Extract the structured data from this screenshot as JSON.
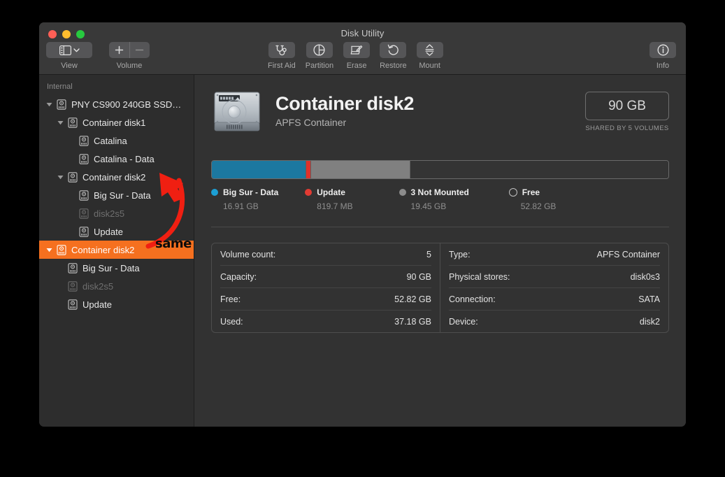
{
  "window": {
    "title": "Disk Utility",
    "traffic_lights": [
      "close",
      "minimize",
      "maximize"
    ]
  },
  "toolbar": {
    "view": {
      "label": "View",
      "icon": "sidebar-icon",
      "chevron": "chevron-down-icon"
    },
    "volume": {
      "label": "Volume",
      "add": "+",
      "remove": "–"
    },
    "actions": [
      {
        "label": "First Aid",
        "icon": "stethoscope-icon"
      },
      {
        "label": "Partition",
        "icon": "pie-chart-icon"
      },
      {
        "label": "Erase",
        "icon": "erase-icon"
      },
      {
        "label": "Restore",
        "icon": "undo-arrow-icon"
      },
      {
        "label": "Mount",
        "icon": "eject-icon"
      }
    ],
    "info": {
      "label": "Info",
      "icon": "info-circle-icon"
    }
  },
  "sidebar": {
    "header": "Internal",
    "items": [
      {
        "label": "PNY CS900 240GB SSD…",
        "indent": 0,
        "twisty": "down",
        "selected": false,
        "dim": false
      },
      {
        "label": "Container disk1",
        "indent": 1,
        "twisty": "down",
        "selected": false,
        "dim": false
      },
      {
        "label": "Catalina",
        "indent": 2,
        "twisty": "none",
        "selected": false,
        "dim": false
      },
      {
        "label": "Catalina - Data",
        "indent": 2,
        "twisty": "none",
        "selected": false,
        "dim": false
      },
      {
        "label": "Container disk2",
        "indent": 1,
        "twisty": "down",
        "selected": false,
        "dim": false
      },
      {
        "label": "Big Sur - Data",
        "indent": 2,
        "twisty": "none",
        "selected": false,
        "dim": false
      },
      {
        "label": "disk2s5",
        "indent": 2,
        "twisty": "none",
        "selected": false,
        "dim": true
      },
      {
        "label": "Update",
        "indent": 2,
        "twisty": "none",
        "selected": false,
        "dim": false
      },
      {
        "label": "Container disk2",
        "indent": 0,
        "twisty": "down",
        "selected": true,
        "dim": false
      },
      {
        "label": "Big Sur - Data",
        "indent": 1,
        "twisty": "none",
        "selected": false,
        "dim": false
      },
      {
        "label": "disk2s5",
        "indent": 1,
        "twisty": "none",
        "selected": false,
        "dim": true
      },
      {
        "label": "Update",
        "indent": 1,
        "twisty": "none",
        "selected": false,
        "dim": false
      }
    ]
  },
  "main": {
    "title": "Container disk2",
    "subtitle": "APFS Container",
    "capacity": "90 GB",
    "capacity_note": "SHARED BY 5 VOLUMES",
    "usage": {
      "segments": [
        {
          "name": "Big Sur - Data",
          "percent": 20.6,
          "color": "#1c78a0"
        },
        {
          "name": "Update",
          "percent": 0.9,
          "color": "#e0312b"
        },
        {
          "name": "3 Not Mounted",
          "percent": 21.7,
          "color": "#808080"
        },
        {
          "name": "Free",
          "percent": 56.8,
          "color": "#343434"
        }
      ],
      "legend": [
        {
          "label": "Big Sur - Data",
          "value": "16.91 GB",
          "color": "#1c9fd4",
          "outline": false
        },
        {
          "label": "Update",
          "value": "819.7 MB",
          "color": "#e23b33",
          "outline": false
        },
        {
          "label": "3 Not Mounted",
          "value": "19.45 GB",
          "color": "#8c8c8c",
          "outline": false
        },
        {
          "label": "Free",
          "value": "52.82 GB",
          "color": "transparent",
          "outline": true
        }
      ]
    },
    "details_left": [
      {
        "label": "Volume count:",
        "value": "5"
      },
      {
        "label": "Capacity:",
        "value": "90 GB"
      },
      {
        "label": "Free:",
        "value": "52.82 GB"
      },
      {
        "label": "Used:",
        "value": "37.18 GB"
      }
    ],
    "details_right": [
      {
        "label": "Type:",
        "value": "APFS Container"
      },
      {
        "label": "Physical stores:",
        "value": "disk0s3"
      },
      {
        "label": "Connection:",
        "value": "SATA"
      },
      {
        "label": "Device:",
        "value": "disk2"
      }
    ]
  },
  "annotation": {
    "text": "same",
    "arrow_color": "#f01f12"
  }
}
